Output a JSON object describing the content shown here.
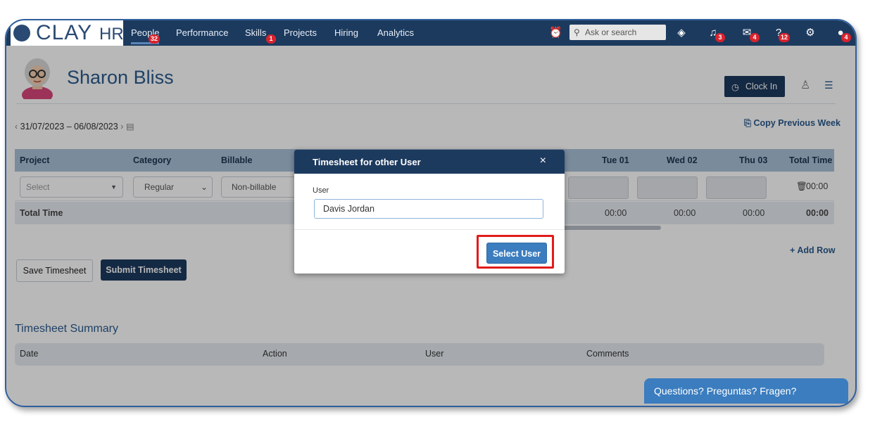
{
  "app": {
    "logo_text": "CLAY",
    "logo_suffix": "HR"
  },
  "nav": {
    "items": [
      {
        "label": "People",
        "badge": "32"
      },
      {
        "label": "Performance"
      },
      {
        "label": "Skills",
        "badge": "1"
      },
      {
        "label": "Projects"
      },
      {
        "label": "Hiring"
      },
      {
        "label": "Analytics"
      }
    ],
    "search_placeholder": "Ask or search",
    "notifications_badge": "3",
    "messages_badge": "4",
    "help_badge": "12",
    "profile_badge": "4"
  },
  "header": {
    "user_name": "Sharon Bliss",
    "clock_in_label": "Clock In"
  },
  "week": {
    "range": "31/07/2023 – 06/08/2023",
    "copy_previous": "Copy Previous Week"
  },
  "table": {
    "columns": [
      "Project",
      "Category",
      "Billable",
      "Tue 01",
      "Wed 02",
      "Thu 03",
      "Total Time"
    ],
    "row": {
      "project_placeholder": "Select",
      "category": "Regular",
      "billable": "Non-billable",
      "total": "00:00"
    },
    "totals": {
      "label": "Total Time",
      "values": [
        "00:00",
        "00:00",
        "00:00",
        "00:00"
      ]
    },
    "add_row": "Add Row"
  },
  "actions": {
    "save": "Save Timesheet",
    "submit": "Submit Timesheet"
  },
  "summary": {
    "title": "Timesheet Summary",
    "columns": [
      "Date",
      "Action",
      "User",
      "Comments"
    ]
  },
  "chat": {
    "label": "Questions? Preguntas? Fragen?"
  },
  "modal": {
    "title": "Timesheet for other User",
    "close": "×",
    "field_label": "User",
    "field_value": "Davis Jordan",
    "select_button": "Select User"
  },
  "colors": {
    "nav_bg": "#1c3a5e",
    "accent": "#3b7dbf",
    "highlight": "#e21b1b"
  }
}
